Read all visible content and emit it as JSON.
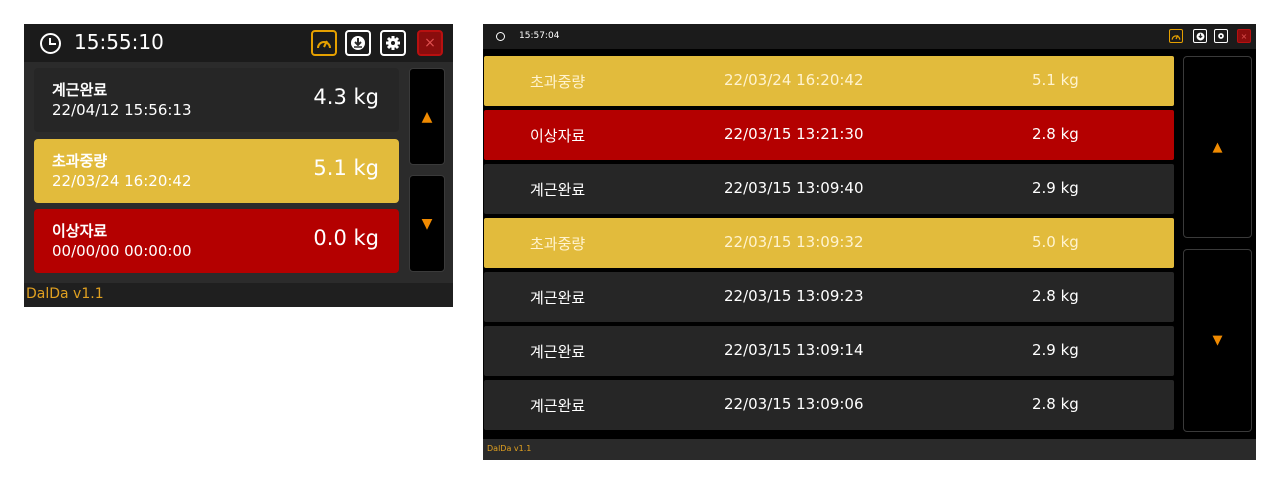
{
  "small": {
    "time": "15:55:10",
    "icons": [
      "clock-icon",
      "gauge-icon",
      "download-icon",
      "gear-icon",
      "close-icon"
    ],
    "close_label": "×",
    "rows": [
      {
        "status": "계근완료",
        "timestamp": "22/04/12 15:56:13",
        "weight": "4.3 kg",
        "type": "normal",
        "color": "#262626"
      },
      {
        "status": "초과중량",
        "timestamp": "22/03/24 16:20:42",
        "weight": "5.1 kg",
        "type": "overweight",
        "color": "#e2bb3c"
      },
      {
        "status": "이상자료",
        "timestamp": "00/00/00 00:00:00",
        "weight": "0.0 kg",
        "type": "error",
        "color": "#b40000"
      }
    ],
    "scroll_up": "▲",
    "scroll_down": "▼",
    "footer": "DalDa v1.1"
  },
  "large": {
    "time": "15:57:04",
    "close_label": "×",
    "rows": [
      {
        "status": "초과중량",
        "timestamp": "22/03/24 16:20:42",
        "weight": "5.1  kg",
        "type": "overweight"
      },
      {
        "status": "이상자료",
        "timestamp": "22/03/15 13:21:30",
        "weight": "2.8  kg",
        "type": "error"
      },
      {
        "status": "계근완료",
        "timestamp": "22/03/15 13:09:40",
        "weight": "2.9  kg",
        "type": "normal"
      },
      {
        "status": "초과중량",
        "timestamp": "22/03/15 13:09:32",
        "weight": "5.0  kg",
        "type": "overweight"
      },
      {
        "status": "계근완료",
        "timestamp": "22/03/15 13:09:23",
        "weight": "2.8  kg",
        "type": "normal"
      },
      {
        "status": "계근완료",
        "timestamp": "22/03/15 13:09:14",
        "weight": "2.9  kg",
        "type": "normal"
      },
      {
        "status": "계근완료",
        "timestamp": "22/03/15 13:09:06",
        "weight": "2.8  kg",
        "type": "normal"
      }
    ],
    "scroll_up": "▲",
    "scroll_down": "▼",
    "footer": "DalDa v1.1"
  },
  "colors": {
    "accent": "#e5a000",
    "overweight": "#e2bb3c",
    "error": "#b40000",
    "normal": "#262626",
    "footer_text": "#e0a020"
  }
}
